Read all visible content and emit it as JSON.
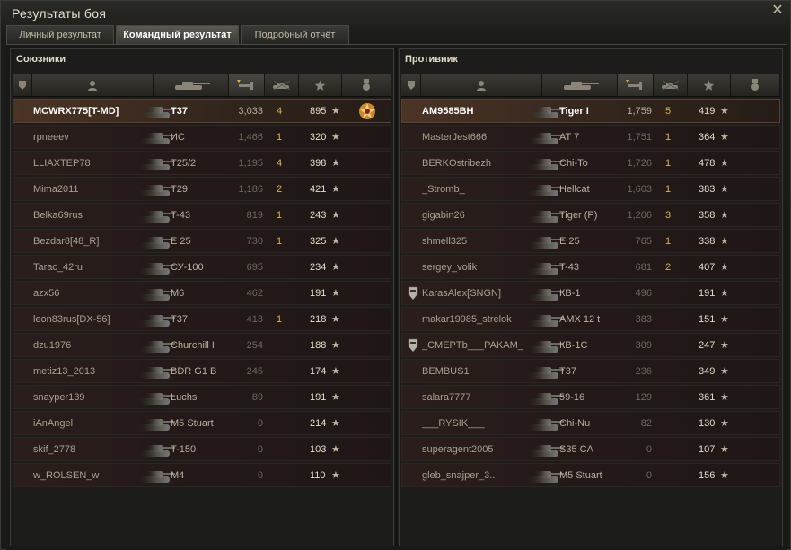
{
  "window": {
    "title": "Результаты боя",
    "close_icon": "close-icon"
  },
  "tabs": [
    {
      "label": "Личный результат",
      "active": false
    },
    {
      "label": "Командный результат",
      "active": true
    },
    {
      "label": "Подробный отчёт",
      "active": false
    }
  ],
  "columns": [
    "platoon-icon",
    "player-icon",
    "tank-icon",
    "damage-icon",
    "kills-icon",
    "xp-star-icon",
    "medal-icon"
  ],
  "allies": {
    "title": "Союзники",
    "rows": [
      {
        "player": "MCWRX775[T-MD]",
        "tank": "T37",
        "damage": "3,033",
        "kills": "4",
        "xp": "895",
        "highlight": true,
        "medal": true
      },
      {
        "player": "rpneeev",
        "tank": "ИС",
        "damage": "1,466",
        "kills": "1",
        "xp": "320"
      },
      {
        "player": "LLIAXTEP78",
        "tank": "T25/2",
        "damage": "1,195",
        "kills": "4",
        "xp": "398"
      },
      {
        "player": "Mima2011",
        "tank": "T29",
        "damage": "1,186",
        "kills": "2",
        "xp": "421"
      },
      {
        "player": "Belka69rus",
        "tank": "T-43",
        "damage": "819",
        "kills": "1",
        "xp": "243"
      },
      {
        "player": "Bezdar8[48_R]",
        "tank": "E 25",
        "damage": "730",
        "kills": "1",
        "xp": "325"
      },
      {
        "player": "Tarac_42ru",
        "tank": "СУ-100",
        "damage": "695",
        "kills": "",
        "xp": "234"
      },
      {
        "player": "azx56",
        "tank": "M6",
        "damage": "462",
        "kills": "",
        "xp": "191"
      },
      {
        "player": "leon83rus[DX-56]",
        "tank": "T37",
        "damage": "413",
        "kills": "1",
        "xp": "218"
      },
      {
        "player": "dzu1976",
        "tank": "Churchill I",
        "damage": "254",
        "kills": "",
        "xp": "188"
      },
      {
        "player": "metiz13_2013",
        "tank": "BDR G1 B",
        "damage": "245",
        "kills": "",
        "xp": "174"
      },
      {
        "player": "snayper139",
        "tank": "Luchs",
        "damage": "89",
        "kills": "",
        "xp": "191"
      },
      {
        "player": "iAnAngel",
        "tank": "M5 Stuart",
        "damage": "0",
        "kills": "",
        "xp": "214"
      },
      {
        "player": "skif_2778",
        "tank": "T-150",
        "damage": "0",
        "kills": "",
        "xp": "103"
      },
      {
        "player": "w_ROLSEN_w",
        "tank": "M4",
        "damage": "0",
        "kills": "",
        "xp": "110"
      }
    ]
  },
  "enemies": {
    "title": "Противник",
    "rows": [
      {
        "player": "AM9585BH",
        "tank": "Tiger I",
        "damage": "1,759",
        "kills": "5",
        "xp": "419",
        "highlight": true
      },
      {
        "player": "MasterJest666",
        "tank": "AT 7",
        "damage": "1,751",
        "kills": "1",
        "xp": "364"
      },
      {
        "player": "BERKOstribezh",
        "tank": "Chi-To",
        "damage": "1,726",
        "kills": "1",
        "xp": "478"
      },
      {
        "player": "_Stromb_",
        "tank": "Hellcat",
        "damage": "1,603",
        "kills": "1",
        "xp": "383"
      },
      {
        "player": "gigabin26",
        "tank": "Tiger (P)",
        "damage": "1,206",
        "kills": "3",
        "xp": "358"
      },
      {
        "player": "shmell325",
        "tank": "E 25",
        "damage": "765",
        "kills": "1",
        "xp": "338"
      },
      {
        "player": "sergey_volik",
        "tank": "T-43",
        "damage": "681",
        "kills": "2",
        "xp": "407"
      },
      {
        "player": "KarasAlex[SNGN]",
        "tank": "КВ-1",
        "damage": "496",
        "kills": "",
        "xp": "191",
        "platoon": true
      },
      {
        "player": "makar19985_strelok",
        "tank": "AMX 12 t",
        "damage": "383",
        "kills": "",
        "xp": "151"
      },
      {
        "player": "_CMEPTb___PAKAM_",
        "tank": "КВ-1С",
        "damage": "309",
        "kills": "",
        "xp": "247",
        "platoon": true
      },
      {
        "player": "BEMBUS1",
        "tank": "T37",
        "damage": "236",
        "kills": "",
        "xp": "349"
      },
      {
        "player": "salara7777",
        "tank": "59-16",
        "damage": "129",
        "kills": "",
        "xp": "361"
      },
      {
        "player": "___RYSIK___",
        "tank": "Chi-Nu",
        "damage": "82",
        "kills": "",
        "xp": "130"
      },
      {
        "player": "superagent2005",
        "tank": "S35 CA",
        "damage": "0",
        "kills": "",
        "xp": "107"
      },
      {
        "player": "gleb_snajper_3..",
        "tank": "M5 Stuart",
        "damage": "0",
        "kills": "",
        "xp": "156"
      }
    ]
  }
}
